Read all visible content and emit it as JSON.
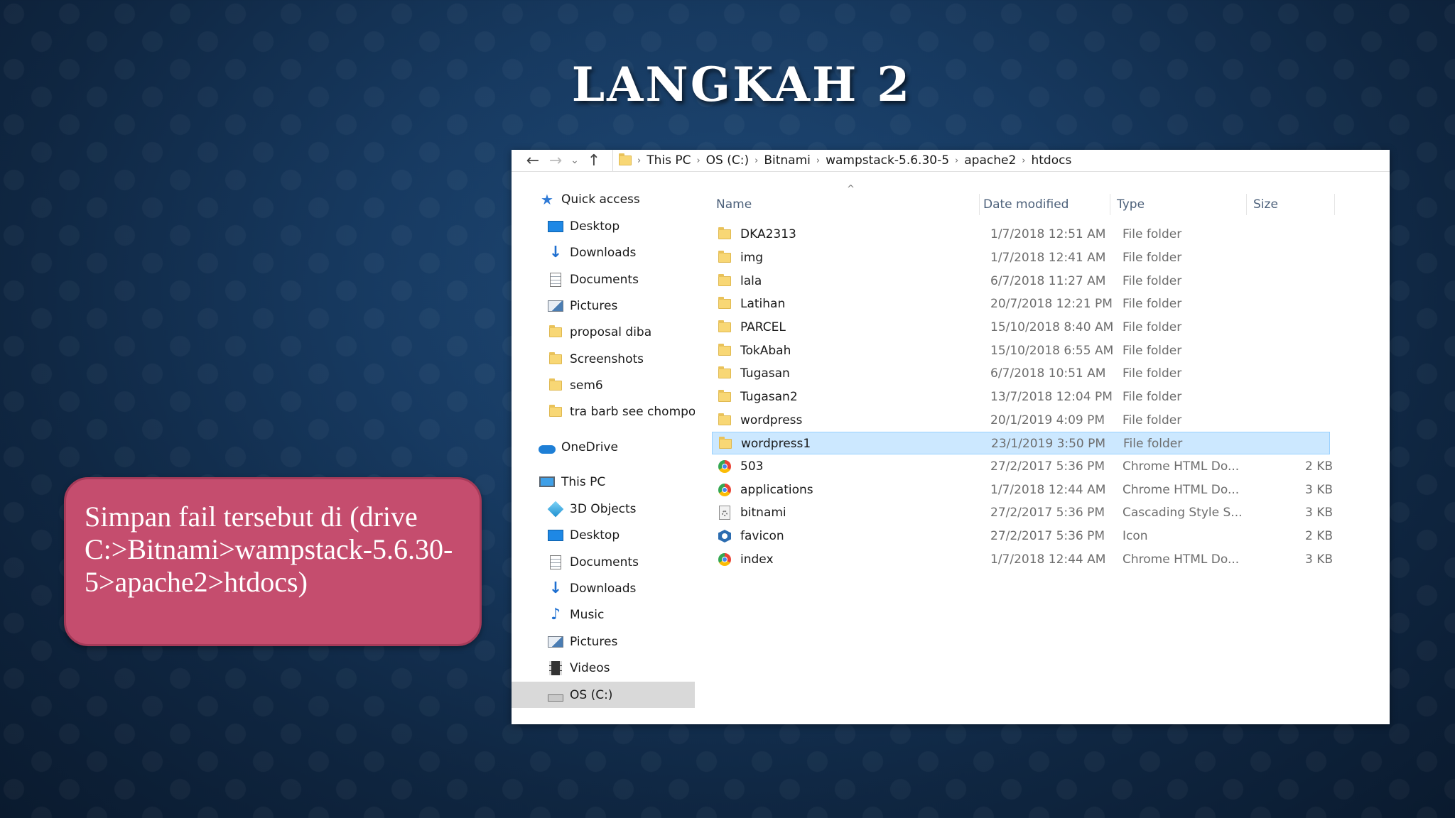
{
  "slide": {
    "title": "LANGKAH 2",
    "callout_text": "Simpan fail tersebut di (drive C:>Bitnami>wampstack-5.6.30-5>apache2>htdocs)"
  },
  "explorer": {
    "nav_buttons": {
      "back": "←",
      "forward": "→",
      "recent": "⌄",
      "up": "↑"
    },
    "breadcrumb": [
      "This PC",
      "OS (C:)",
      "Bitnami",
      "wampstack-5.6.30-5",
      "apache2",
      "htdocs"
    ],
    "breadcrumb_separator": "›",
    "nav_pane": {
      "pin_symbol": "📌",
      "items": [
        {
          "label": "Quick access",
          "icon": "star-icon",
          "pinned": false
        },
        {
          "label": "Desktop",
          "icon": "desktop-icon",
          "pinned": true
        },
        {
          "label": "Downloads",
          "icon": "download-arrow-icon",
          "pinned": true
        },
        {
          "label": "Documents",
          "icon": "documents-icon",
          "pinned": true
        },
        {
          "label": "Pictures",
          "icon": "pictures-icon",
          "pinned": true
        },
        {
          "label": "proposal diba",
          "icon": "folder-icon",
          "pinned": false
        },
        {
          "label": "Screenshots",
          "icon": "folder-icon",
          "pinned": false
        },
        {
          "label": "sem6",
          "icon": "folder-icon",
          "pinned": false
        },
        {
          "label": "tra barb see chompoo",
          "icon": "folder-icon",
          "pinned": false
        },
        {
          "label": "OneDrive",
          "icon": "cloud-icon",
          "pinned": false
        },
        {
          "label": "This PC",
          "icon": "computer-icon",
          "pinned": false
        },
        {
          "label": "3D Objects",
          "icon": "cube-icon",
          "pinned": false
        },
        {
          "label": "Desktop",
          "icon": "desktop-icon",
          "pinned": false
        },
        {
          "label": "Documents",
          "icon": "documents-icon",
          "pinned": false
        },
        {
          "label": "Downloads",
          "icon": "download-arrow-icon",
          "pinned": false
        },
        {
          "label": "Music",
          "icon": "music-icon",
          "pinned": false
        },
        {
          "label": "Pictures",
          "icon": "pictures-icon",
          "pinned": false
        },
        {
          "label": "Videos",
          "icon": "videos-icon",
          "pinned": false
        },
        {
          "label": "OS (C:)",
          "icon": "drive-icon",
          "pinned": false,
          "selected": true
        }
      ]
    },
    "columns": {
      "name": "Name",
      "date": "Date modified",
      "type": "Type",
      "size": "Size",
      "sort_indicator": "^"
    },
    "files": [
      {
        "name": "DKA2313",
        "date": "1/7/2018 12:51 AM",
        "type": "File folder",
        "size": "",
        "icon": "folder-icon"
      },
      {
        "name": "img",
        "date": "1/7/2018 12:41 AM",
        "type": "File folder",
        "size": "",
        "icon": "folder-icon"
      },
      {
        "name": "lala",
        "date": "6/7/2018 11:27 AM",
        "type": "File folder",
        "size": "",
        "icon": "folder-icon"
      },
      {
        "name": "Latihan",
        "date": "20/7/2018 12:21 PM",
        "type": "File folder",
        "size": "",
        "icon": "folder-icon"
      },
      {
        "name": "PARCEL",
        "date": "15/10/2018 8:40 AM",
        "type": "File folder",
        "size": "",
        "icon": "folder-icon"
      },
      {
        "name": "TokAbah",
        "date": "15/10/2018 6:55 AM",
        "type": "File folder",
        "size": "",
        "icon": "folder-icon"
      },
      {
        "name": "Tugasan",
        "date": "6/7/2018 10:51 AM",
        "type": "File folder",
        "size": "",
        "icon": "folder-icon"
      },
      {
        "name": "Tugasan2",
        "date": "13/7/2018 12:04 PM",
        "type": "File folder",
        "size": "",
        "icon": "folder-icon"
      },
      {
        "name": "wordpress",
        "date": "20/1/2019 4:09 PM",
        "type": "File folder",
        "size": "",
        "icon": "folder-icon"
      },
      {
        "name": "wordpress1",
        "date": "23/1/2019 3:50 PM",
        "type": "File folder",
        "size": "",
        "icon": "folder-icon",
        "selected": true
      },
      {
        "name": "503",
        "date": "27/2/2017 5:36 PM",
        "type": "Chrome HTML Do...",
        "size": "2 KB",
        "icon": "chrome-icon"
      },
      {
        "name": "applications",
        "date": "1/7/2018 12:44 AM",
        "type": "Chrome HTML Do...",
        "size": "3 KB",
        "icon": "chrome-icon"
      },
      {
        "name": "bitnami",
        "date": "27/2/2017 5:36 PM",
        "type": "Cascading Style S...",
        "size": "3 KB",
        "icon": "css-file-icon"
      },
      {
        "name": "favicon",
        "date": "27/2/2017 5:36 PM",
        "type": "Icon",
        "size": "2 KB",
        "icon": "favicon-icon"
      },
      {
        "name": "index",
        "date": "1/7/2018 12:44 AM",
        "type": "Chrome HTML Do...",
        "size": "3 KB",
        "icon": "chrome-icon"
      }
    ]
  },
  "colors": {
    "callout_fill": "#c54d6e",
    "selection_fill": "#cce8ff",
    "folder_yellow": "#f8d775"
  }
}
